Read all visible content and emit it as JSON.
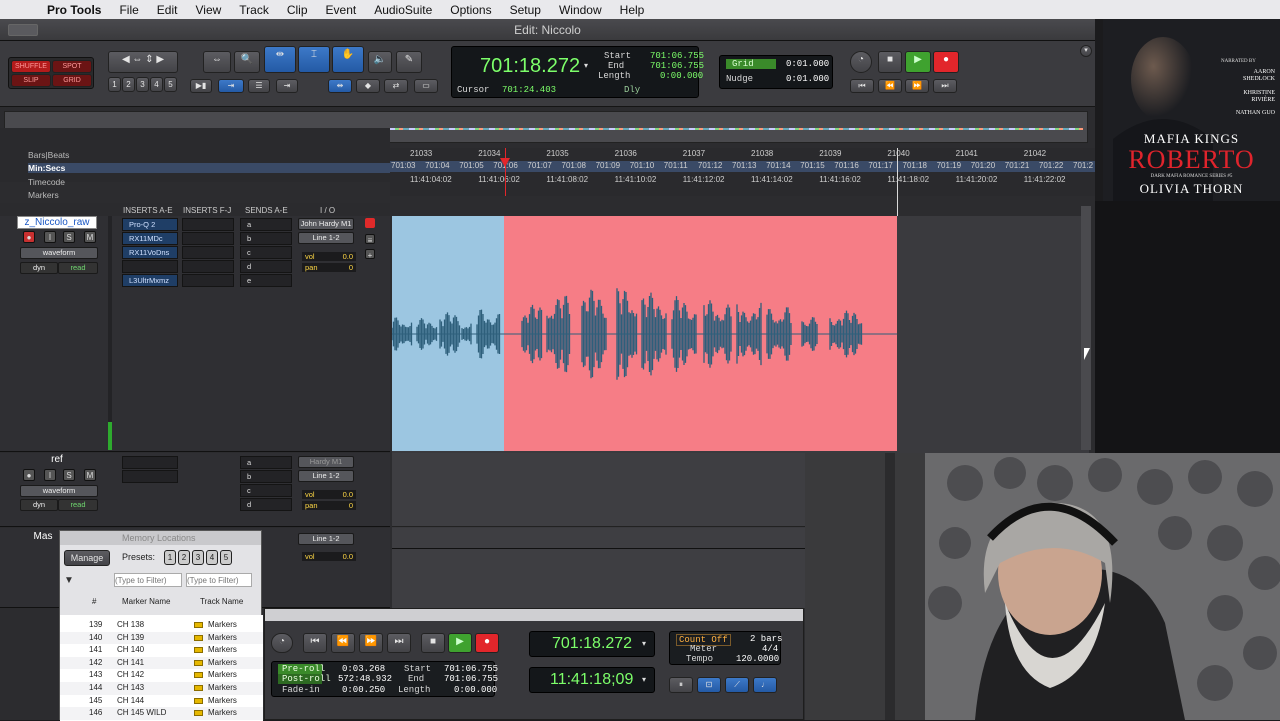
{
  "menubar": {
    "app": "Pro Tools",
    "items": [
      "File",
      "Edit",
      "View",
      "Track",
      "Clip",
      "Event",
      "AudioSuite",
      "Options",
      "Setup",
      "Window",
      "Help"
    ]
  },
  "window": {
    "title": "Edit: Niccolo"
  },
  "toolbar": {
    "modes": {
      "shuffle": "SHUFFLE",
      "spot": "SPOT",
      "slip": "SLIP",
      "grid": "GRID"
    },
    "zoom_presets": [
      "1",
      "2",
      "3",
      "4",
      "5"
    ],
    "main_counter": "701:18.272",
    "sel_start_label": "Start",
    "sel_start": "701:06.755",
    "sel_end_label": "End",
    "sel_end": "701:06.755",
    "sel_length_label": "Length",
    "sel_length": "0:00.000",
    "cursor_label": "Cursor",
    "cursor": "701:24.403",
    "dly_label": "Dly",
    "grid_label": "Grid",
    "grid_value": "0:01.000",
    "nudge_label": "Nudge",
    "nudge_value": "0:01.000"
  },
  "rulers": {
    "labels": {
      "bars": "Bars|Beats",
      "minsecs": "Min:Secs",
      "timecode": "Timecode",
      "markers": "Markers"
    },
    "bars": [
      "21033",
      "21034",
      "21035",
      "21036",
      "21037",
      "21038",
      "21039",
      "21040",
      "21041",
      "21042"
    ],
    "minsecs": [
      "701:03",
      "701:04",
      "701:05",
      "701:06",
      "701:07",
      "701:08",
      "701:09",
      "701:10",
      "701:11",
      "701:12",
      "701:13",
      "701:14",
      "701:15",
      "701:16",
      "701:17",
      "701:18",
      "701:19",
      "701:20",
      "701:21",
      "701:22",
      "701:2"
    ],
    "timecode": [
      "11:41:04:02",
      "11:41:06:02",
      "11:41:08:02",
      "11:41:10:02",
      "11:41:12:02",
      "11:41:14:02",
      "11:41:16:02",
      "11:41:18:02",
      "11:41:20:02",
      "11:41:22:02"
    ]
  },
  "columns": {
    "inserts_ae": "INSERTS A-E",
    "inserts_fj": "INSERTS F-J",
    "sends_ae": "SENDS A-E",
    "io": "I / O"
  },
  "tracks": [
    {
      "name": "z_Niccolo_raw",
      "view": "waveform",
      "auto_label": "dyn",
      "auto_mode": "read",
      "inserts": [
        "Pro-Q 2",
        "RX11MDc",
        "RX11VoDns",
        "",
        "L3UltrMxmz"
      ],
      "sends": [
        "a",
        "b",
        "c",
        "d",
        "e"
      ],
      "input": "John Hardy M1",
      "output": "Line 1-2",
      "vol": "0.0",
      "pan": "0"
    },
    {
      "name": "ref",
      "view": "waveform",
      "auto_label": "dyn",
      "auto_mode": "read",
      "inserts": [
        "",
        "",
        "",
        "",
        ""
      ],
      "sends": [
        "a",
        "b",
        "c",
        "d",
        "e"
      ],
      "input": "Hardy M1",
      "output": "Line 1-2",
      "vol": "0.0",
      "pan": "0"
    },
    {
      "name": "Mas",
      "output": "Line 1-2",
      "vol": "0.0"
    }
  ],
  "memory_locations": {
    "title": "Memory Locations",
    "manage": "Manage",
    "presets_label": "Presets:",
    "presets": [
      "1",
      "2",
      "3",
      "4",
      "5"
    ],
    "filter_placeholder": "(Type to Filter)",
    "col_num": "#",
    "col_marker": "Marker Name",
    "col_track": "Track Name",
    "rows": [
      {
        "num": "139",
        "name": "CH 138",
        "track": "Markers"
      },
      {
        "num": "140",
        "name": "CH 139",
        "track": "Markers"
      },
      {
        "num": "141",
        "name": "CH 140",
        "track": "Markers"
      },
      {
        "num": "142",
        "name": "CH 141",
        "track": "Markers"
      },
      {
        "num": "143",
        "name": "CH 142",
        "track": "Markers"
      },
      {
        "num": "144",
        "name": "CH 143",
        "track": "Markers"
      },
      {
        "num": "145",
        "name": "CH 144",
        "track": "Markers"
      },
      {
        "num": "146",
        "name": "CH 145 WILD",
        "track": "Markers"
      }
    ]
  },
  "transport": {
    "preroll_label": "Pre-roll",
    "preroll": "0:03.268",
    "postroll_label": "Post-roll",
    "postroll": "572:48.932",
    "fadein_label": "Fade-in",
    "fadein": "0:00.250",
    "start_label": "Start",
    "start": "701:06.755",
    "end_label": "End",
    "end": "701:06.755",
    "length_label": "Length",
    "length": "0:00.000",
    "main_counter": "701:18.272",
    "sub_counter": "11:41:18;09",
    "count_off": "Count Off",
    "bars": "2 bars",
    "meter_label": "Meter",
    "meter": "4/4",
    "tempo_label": "Tempo",
    "tempo": "120.0000"
  },
  "book_cover": {
    "narrated_by": "NARRATED BY",
    "narrators": [
      "AARON SHEDLOCK",
      "KHRISTINE RIVIÈRE",
      "NATHAN GUO"
    ],
    "series": "MAFIA KINGS",
    "title": "ROBERTO",
    "subtitle": "DARK MAFIA ROMANCE SERIES #5",
    "author": "OLIVIA THORN"
  },
  "colors": {
    "clip_blue": "#9cc6e1",
    "clip_pink": "#f67d86",
    "waveform": "#2e5f7b",
    "counter_green": "#7dff6a",
    "record_red": "#e2262b"
  }
}
